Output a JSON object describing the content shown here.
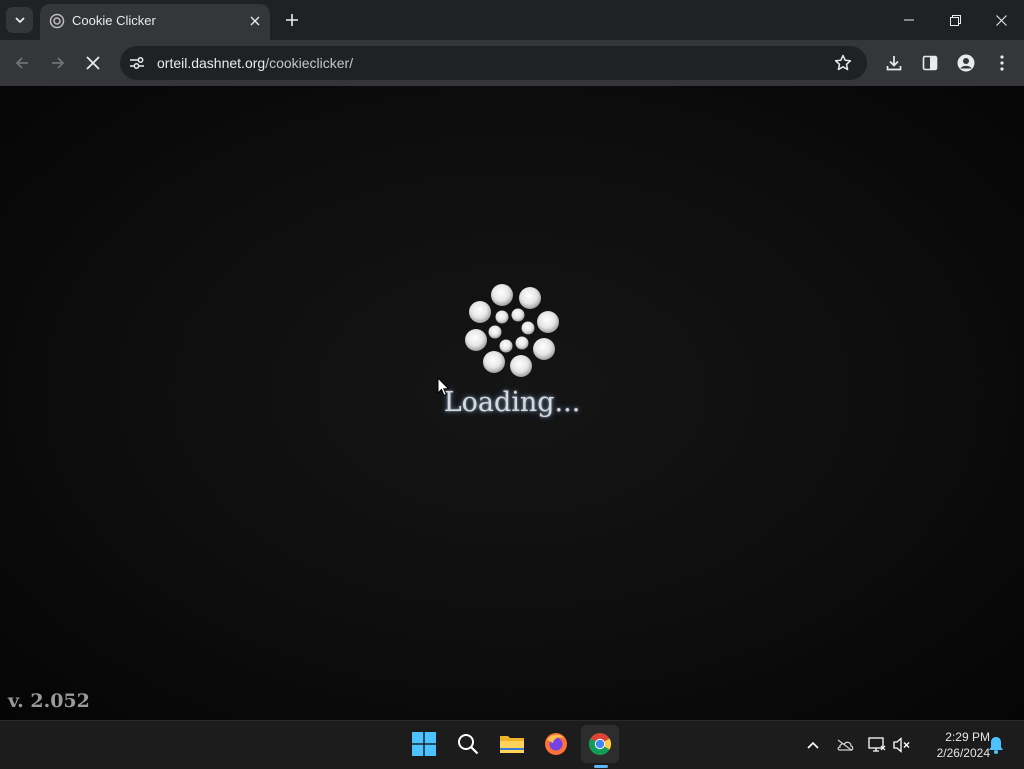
{
  "browser": {
    "tab": {
      "title": "Cookie Clicker",
      "favicon": "cookie-clicker-favicon"
    },
    "address_bar": {
      "domain": "orteil.dashnet.org",
      "path": "/cookieclicker/"
    },
    "icons": [
      "tab-search-icon",
      "close-icon",
      "plus-icon",
      "minimize-icon",
      "restore-icon",
      "window-close-icon",
      "back-icon",
      "forward-icon",
      "stop-loading-icon",
      "site-info-icon",
      "star-icon",
      "download-icon",
      "side-panel-icon",
      "profile-icon",
      "more-menu-icon"
    ]
  },
  "page": {
    "loading_text": "Loading...",
    "version": "v. 2.052"
  },
  "taskbar": {
    "apps": [
      "windows-start-icon",
      "search-icon",
      "file-explorer-icon",
      "firefox-icon",
      "chrome-icon"
    ],
    "tray_icons": [
      "chevron-up-icon",
      "onedrive-icon",
      "network-icon",
      "volume-muted-icon",
      "notification-bell-icon"
    ],
    "time": "2:29 PM",
    "date": "2/26/2024"
  },
  "colors": {
    "tabstrip": "#202124",
    "toolbar": "#35363a",
    "accent": "#64b5f6",
    "page_bg": "#0f0f0f"
  }
}
